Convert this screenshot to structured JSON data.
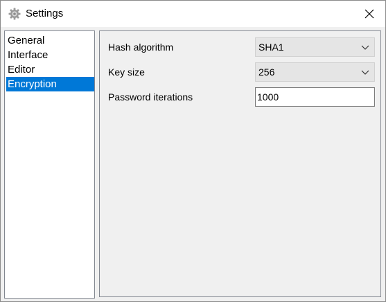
{
  "window": {
    "title": "Settings",
    "icon": "gear-icon"
  },
  "sidebar": {
    "items": [
      {
        "label": "General",
        "selected": false
      },
      {
        "label": "Interface",
        "selected": false
      },
      {
        "label": "Editor",
        "selected": false
      },
      {
        "label": "Encryption",
        "selected": true
      }
    ]
  },
  "encryption": {
    "hash_algorithm": {
      "label": "Hash algorithm",
      "value": "SHA1"
    },
    "key_size": {
      "label": "Key size",
      "value": "256"
    },
    "password_iterations": {
      "label": "Password iterations",
      "value": "1000"
    }
  },
  "colors": {
    "selection": "#0078d7",
    "panel_background": "#f0f0f0"
  }
}
